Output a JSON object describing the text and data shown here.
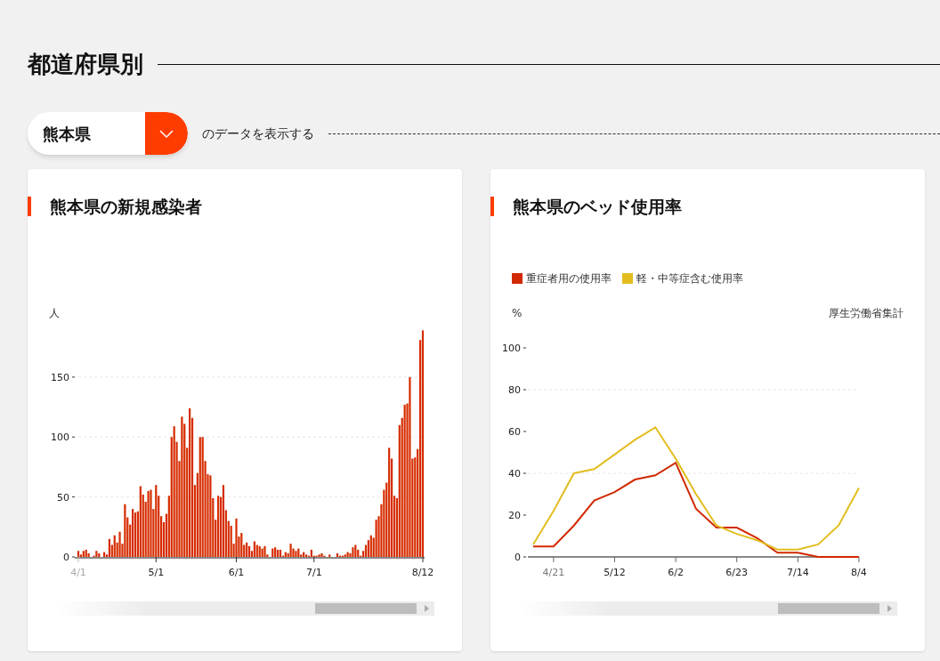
{
  "section": {
    "title": "都道府県別"
  },
  "selector": {
    "value": "熊本県",
    "suffix": "のデータを表示する"
  },
  "cards": [
    {
      "title": "熊本県の新規感染者",
      "chart_data": {
        "type": "bar",
        "ylabel": "人",
        "yticks": [
          0,
          50,
          100,
          150
        ],
        "ylim": [
          0,
          190
        ],
        "grid": true,
        "color": "#d62c00",
        "categories": [
          "4/1",
          null,
          null,
          null,
          null,
          null,
          null,
          null,
          null,
          null,
          null,
          null,
          null,
          null,
          null,
          null,
          null,
          null,
          null,
          null,
          null,
          null,
          null,
          null,
          null,
          null,
          null,
          null,
          null,
          null,
          "5/1",
          null,
          null,
          null,
          null,
          null,
          null,
          null,
          null,
          null,
          null,
          null,
          null,
          null,
          null,
          null,
          null,
          null,
          null,
          null,
          null,
          null,
          null,
          null,
          null,
          null,
          null,
          null,
          null,
          null,
          null,
          "6/1",
          null,
          null,
          null,
          null,
          null,
          null,
          null,
          null,
          null,
          null,
          null,
          null,
          null,
          null,
          null,
          null,
          null,
          null,
          null,
          null,
          null,
          null,
          null,
          null,
          null,
          null,
          null,
          null,
          null,
          "7/1",
          null,
          null,
          null,
          null,
          null,
          null,
          null,
          null,
          null,
          null,
          null,
          null,
          null,
          null,
          null,
          null,
          null,
          null,
          null,
          null,
          null,
          null,
          null,
          null,
          null,
          null,
          null,
          null,
          null,
          null,
          null,
          null,
          null,
          null,
          null,
          null,
          null,
          null,
          null,
          null,
          null,
          "8/12"
        ],
        "values": [
          5,
          2,
          5,
          6,
          3,
          0,
          1,
          5,
          3,
          0,
          4,
          2,
          15,
          10,
          18,
          12,
          21,
          11,
          44,
          33,
          27,
          40,
          37,
          38,
          59,
          52,
          46,
          55,
          56,
          40,
          60,
          51,
          34,
          29,
          36,
          51,
          100,
          109,
          96,
          80,
          117,
          111,
          91,
          124,
          116,
          60,
          70,
          100,
          100,
          80,
          69,
          68,
          49,
          31,
          51,
          50,
          60,
          39,
          30,
          26,
          11,
          32,
          17,
          20,
          10,
          12,
          9,
          5,
          13,
          10,
          9,
          7,
          9,
          2,
          0,
          7,
          8,
          6,
          6,
          1,
          4,
          3,
          11,
          7,
          5,
          7,
          2,
          4,
          2,
          1,
          6,
          1,
          1,
          2,
          3,
          1,
          0,
          2,
          0,
          0,
          3,
          1,
          1,
          2,
          4,
          3,
          8,
          10,
          6,
          1,
          5,
          10,
          14,
          18,
          16,
          31,
          34,
          44,
          56,
          62,
          91,
          82,
          51,
          49,
          110,
          116,
          127,
          128,
          150,
          82,
          83,
          90,
          181,
          189
        ]
      }
    },
    {
      "title": "熊本県のベッド使用率",
      "note": "厚生労働省集計",
      "chart_data": {
        "type": "line",
        "ylabel": "%",
        "ylim": [
          0,
          100
        ],
        "yticks": [
          0,
          20,
          40,
          60,
          80,
          100
        ],
        "grid": true,
        "categories": [
          null,
          "4/21",
          null,
          null,
          "5/12",
          null,
          null,
          "6/2",
          null,
          null,
          "6/23",
          null,
          null,
          "7/14",
          null,
          null,
          "8/4"
        ],
        "series": [
          {
            "name": "重症者用の使用率",
            "color": "#d12a00",
            "values": [
              5,
              5,
              15,
              27,
              31,
              37,
              39,
              45,
              23,
              14,
              14,
              9,
              2,
              2,
              0,
              0,
              0
            ]
          },
          {
            "name": "軽・中等症含む使用率",
            "color": "#e3bd1f",
            "values": [
              6,
              22,
              40,
              42,
              49,
              56,
              62,
              47,
              30,
              15,
              11,
              8,
              3.5,
              3.5,
              6,
              15,
              33
            ]
          }
        ]
      }
    }
  ]
}
